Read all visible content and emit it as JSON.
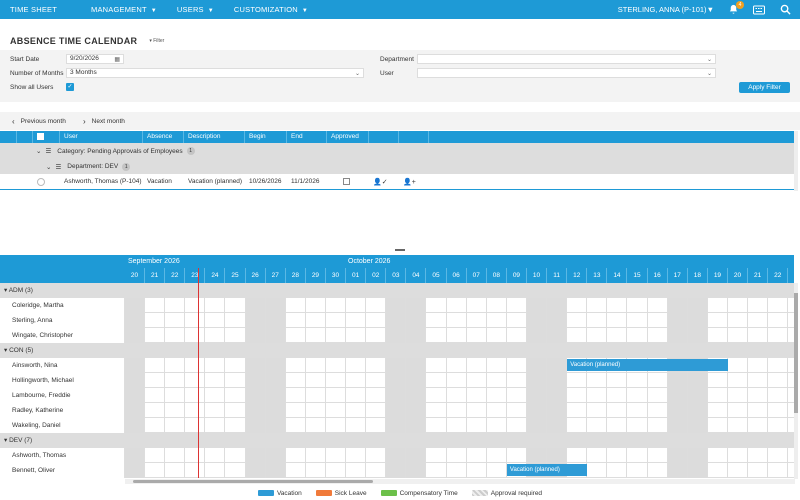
{
  "colors": {
    "accent": "#1e9ad6",
    "vacation": "#2e9bd6",
    "sick": "#f07a3a",
    "comp": "#6cc04a",
    "approval": "#cccccc",
    "today": "#d33"
  },
  "topbar": {
    "items": [
      "TIME SHEET",
      "MANAGEMENT",
      "USERS",
      "CUSTOMIZATION"
    ],
    "user": "STERLING, ANNA (P-101)",
    "notifications": "4"
  },
  "title": "ABSENCE TIME CALENDAR",
  "filter_toggle": "Filter",
  "filter": {
    "start_date_label": "Start Date",
    "start_date": "9/20/2026",
    "months_label": "Number of Months",
    "months": "3 Months",
    "show_all_label": "Show all Users",
    "department_label": "Department",
    "department": "",
    "user_label": "User",
    "user": "",
    "apply": "Apply Filter"
  },
  "nav": {
    "prev": "Previous month",
    "next": "Next month"
  },
  "grid": {
    "columns": [
      "User",
      "Absence",
      "Description",
      "Begin",
      "End",
      "Approved"
    ],
    "category": "Category: Pending Approvals of Employees",
    "category_count": "1",
    "department": "Department: DEV",
    "department_count": "1",
    "row": {
      "user": "Ashworth, Thomas (P-104)",
      "absence": "Vacation",
      "description": "Vacation (planned)",
      "begin": "10/26/2026",
      "end": "11/1/2026"
    }
  },
  "timeline": {
    "months": [
      "September 2026",
      "October 2026"
    ],
    "days": [
      "20",
      "21",
      "22",
      "23",
      "24",
      "25",
      "26",
      "27",
      "28",
      "29",
      "30",
      "01",
      "02",
      "03",
      "04",
      "05",
      "06",
      "07",
      "08",
      "09",
      "10",
      "11",
      "12",
      "13",
      "14",
      "15",
      "16",
      "17",
      "18",
      "19",
      "20",
      "21",
      "22"
    ],
    "weekend_days": [
      0,
      6,
      7,
      13,
      14,
      20,
      21,
      27,
      28
    ],
    "groups": [
      {
        "name": "ADM (3)",
        "members": [
          "Coleridge, Martha",
          "Sterling, Anna",
          "Wingate, Christopher"
        ]
      },
      {
        "name": "CON (5)",
        "members": [
          "Ainsworth, Nina",
          "Hollingworth, Michael",
          "Lambourne, Freddie",
          "Radley, Katherine",
          "Wakeling, Daniel"
        ]
      },
      {
        "name": "DEV (7)",
        "members": [
          "Ashworth, Thomas",
          "Bennett, Oliver"
        ]
      }
    ],
    "bars": [
      {
        "row": "Ainsworth, Nina",
        "label": "Vacation (planned)",
        "start_index": 22,
        "end_index": 30
      },
      {
        "row": "Bennett, Oliver",
        "label": "Vacation (planned)",
        "start_index": 19,
        "end_index": 23
      }
    ]
  },
  "legend": [
    "Vacation",
    "Sick Leave",
    "Compensatory Time",
    "Approval required"
  ]
}
